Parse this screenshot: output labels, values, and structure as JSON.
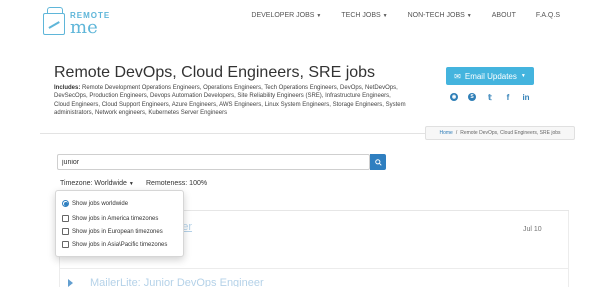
{
  "logo": {
    "line1": "REMOTE",
    "line2": "me"
  },
  "nav": [
    {
      "label": "DEVELOPER JOBS",
      "dropdown": true
    },
    {
      "label": "TECH JOBS",
      "dropdown": true
    },
    {
      "label": "NON-TECH JOBS",
      "dropdown": true
    },
    {
      "label": "ABOUT",
      "dropdown": false
    },
    {
      "label": "F.A.Q.S",
      "dropdown": false
    }
  ],
  "page": {
    "title": "Remote DevOps, Cloud Engineers, SRE jobs",
    "includes_label": "Includes:",
    "includes_text": "Remote Development Operations Engineers, Operations Engineers, Tech Operations Engineers, DevOps, NetDevOps, DevSecOps, Production Engineers, Devops Automation Developers, Site Reliability Engineers (SRE), Infrastructure Engineers, Cloud Engineers, Cloud Support Engineers, Azure Engineers, AWS Engineers, Linux System Engineers, Storage Engineers, System administrators, Network engineers, Kubernetes Server Engineers"
  },
  "email_updates": {
    "label": "Email Updates"
  },
  "social": [
    "rss-icon",
    "skype-icon",
    "twitter-icon",
    "linkedin-icon"
  ],
  "breadcrumb": {
    "home": "Home",
    "separator": "/",
    "current": "Remote DevOps, Cloud Engineers, SRE jobs"
  },
  "search": {
    "value": "junior"
  },
  "filters": {
    "timezone_label": "Timezone: Worldwide",
    "remoteness_label": "Remoteness: 100%"
  },
  "timezone_options": [
    {
      "label": "Show jobs worldwide",
      "type": "radio",
      "checked": true
    },
    {
      "label": "Show jobs in America timezones",
      "type": "checkbox",
      "checked": false
    },
    {
      "label": "Show jobs in European timezones",
      "type": "checkbox",
      "checked": false
    },
    {
      "label": "Show jobs in Asia\\Pacific timezones",
      "type": "checkbox",
      "checked": false
    }
  ],
  "jobs": [
    {
      "title_visible": "neer",
      "date": "Jul 10"
    },
    {
      "title": "MailerLite: Junior DevOps Engineer"
    }
  ],
  "colors": {
    "accent": "#44b4de",
    "link": "#2f7fc0"
  }
}
